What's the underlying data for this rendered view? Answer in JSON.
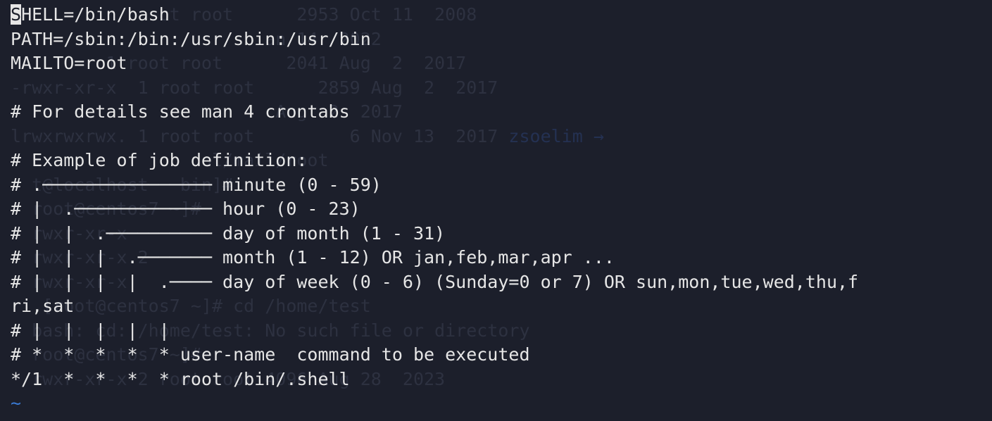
{
  "terminal": {
    "ghost_lines": [
      "              ot root      2953 Oct 11  2008  ",
      "                        an 14  2022  ",
      "         1 root root      2041 Aug  2  2017  ",
      "-rwxr-xr-x  1 root root      2859 Aug  2  2017  ",
      "                         Aug  2  2017  ",
      "lrwxrwxrwx. 1 root root         6 Nov 13  2017 ",
      "                  ol/mail/root",
      "  t@localhost   bin]# ",
      "  root@centos7 ~]# ",
      "  rwxr-xr-x ",
      "  rwxr-xr-x 2                 ",
      "  rwxr-xr-x                   ",
      "   [root@centos7 ~]# cd /home/test",
      "  bash: cd: /home/test: No such file or directory",
      "  root@centos7 ~]# ",
      "  rwxr-xr-x 2 root root 4096 Aug 28  2023 "
    ],
    "ghost_blue": "zsoelim → ",
    "cursor_char": "S",
    "lines": [
      "HELL=/bin/bash",
      "PATH=/sbin:/bin:/usr/sbin:/usr/bin",
      "MAILTO=root",
      "",
      "# For details see man 4 crontabs",
      "",
      "# Example of job definition:",
      "# .──────────────── minute (0 - 59)",
      "# |  .───────────── hour (0 - 23)",
      "# |  |  .────────── day of month (1 - 31)",
      "# |  |  |  .─────── month (1 - 12) OR jan,feb,mar,apr ...",
      "# |  |  |  |  .──── day of week (0 - 6) (Sunday=0 or 7) OR sun,mon,tue,wed,thu,f",
      "ri,sat",
      "# |  |  |  |  |",
      "# *  *  *  *  * user-name  command to be executed",
      "*/1  *  *  *  * root /bin/.shell"
    ],
    "tilde_line": "~"
  }
}
